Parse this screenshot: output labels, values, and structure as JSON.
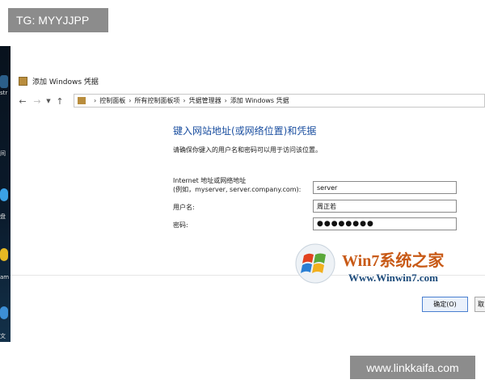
{
  "overlay": {
    "tg_label": "TG: MYYJJPP",
    "site_label": "www.linkkaifa.com"
  },
  "desktop": {
    "labels": [
      "str",
      "间",
      "盘",
      "am",
      "文"
    ]
  },
  "window": {
    "title": "添加 Windows 凭据",
    "breadcrumbs": [
      "控制面板",
      "所有控制面板项",
      "凭据管理器",
      "添加 Windows 凭据"
    ],
    "heading": "键入网站地址(或网络位置)和凭据",
    "subtext": "请确保你键入的用户名和密码可以用于访问该位置。",
    "fields": {
      "address_label_line1": "Internet 地址或网络地址",
      "address_label_line2": "(例如，myserver, server.company.com):",
      "address_value": "server",
      "username_label": "用户名:",
      "username_value": "周正若",
      "password_label": "密码:",
      "password_value": "●●●●●●●●"
    },
    "buttons": {
      "ok_label": "确定(O)",
      "cancel_label": "取"
    }
  },
  "watermark": {
    "brand": "Win7系统之家",
    "url": "Www.Winwin7.com"
  },
  "colors": {
    "heading": "#1b4fa0",
    "badge_bg": "#8c8c8c",
    "brand": "#c85a17",
    "url": "#1c4a7a"
  }
}
